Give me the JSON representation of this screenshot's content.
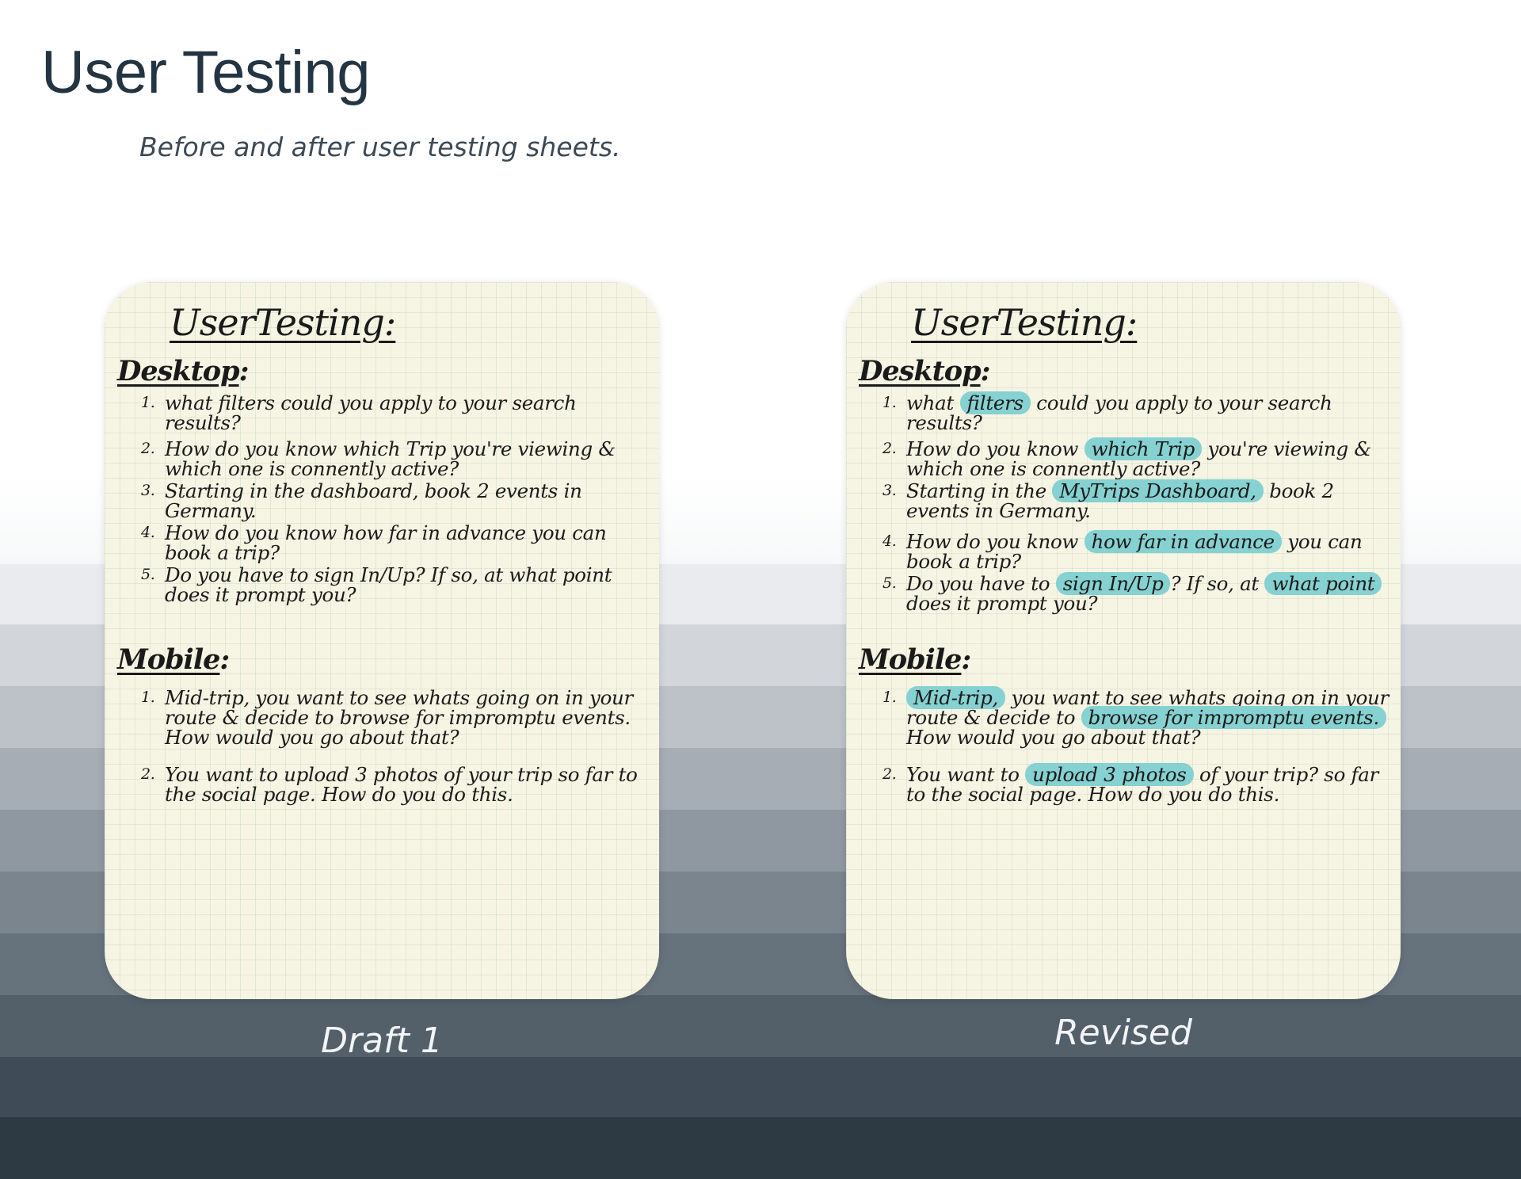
{
  "header": {
    "title": "User Testing",
    "subtitle": "Before and after user testing sheets."
  },
  "background": {
    "band_colors": [
      "#ffffff",
      "#e9ebee",
      "#d2d6da",
      "#bcc2c8",
      "#a6adb4",
      "#8f98a1",
      "#7b858e",
      "#66727c",
      "#535f69",
      "#3f4c57",
      "#2d3a44"
    ]
  },
  "colors": {
    "title": "#233442",
    "paper": "#f6f4e3",
    "highlight": "#86d1d1"
  },
  "sheets": [
    {
      "caption": "Draft 1",
      "title": "UserTesting:",
      "desktop": {
        "heading": "Desktop",
        "questions": [
          {
            "num": "1.",
            "parts": [
              {
                "t": "what filters could you apply to your search results?"
              }
            ]
          },
          {
            "num": "2.",
            "parts": [
              {
                "t": "How do you know which Trip you're viewing & which one is connently active?"
              }
            ]
          },
          {
            "num": "3.",
            "parts": [
              {
                "t": "Starting in the dashboard, book 2 events in Germany."
              }
            ]
          },
          {
            "num": "4.",
            "parts": [
              {
                "t": "How do you know how far in advance you can book a trip?"
              }
            ]
          },
          {
            "num": "5.",
            "parts": [
              {
                "t": "Do you have to sign In/Up? If so, at what point does it prompt you?"
              }
            ]
          }
        ]
      },
      "mobile": {
        "heading": "Mobile",
        "questions": [
          {
            "num": "1.",
            "parts": [
              {
                "t": "Mid-trip, you want to see whats going on in your route & decide to browse for impromptu events. How would you go about that?"
              }
            ]
          },
          {
            "num": "2.",
            "parts": [
              {
                "t": "You want to upload 3 photos of your trip so far to the social page. How do you do this."
              }
            ]
          }
        ]
      }
    },
    {
      "caption": "Revised",
      "title": "UserTesting:",
      "desktop": {
        "heading": "Desktop",
        "questions": [
          {
            "num": "1.",
            "parts": [
              {
                "t": "what "
              },
              {
                "t": "filters",
                "hl": true
              },
              {
                "t": " could you apply to your search results?"
              }
            ]
          },
          {
            "num": "2.",
            "parts": [
              {
                "t": "How do you know "
              },
              {
                "t": "which Trip",
                "hl": true
              },
              {
                "t": " you're viewing & which one is connently active?"
              }
            ]
          },
          {
            "num": "3.",
            "parts": [
              {
                "t": "Starting in the "
              },
              {
                "t": "MyTrips Dashboard,",
                "hl": true
              },
              {
                "t": " book 2 events in Germany."
              }
            ]
          },
          {
            "num": "4.",
            "parts": [
              {
                "t": "How do you know "
              },
              {
                "t": "how far in advance",
                "hl": true
              },
              {
                "t": " you can book a trip?"
              }
            ]
          },
          {
            "num": "5.",
            "parts": [
              {
                "t": "Do you have to "
              },
              {
                "t": "sign In/Up",
                "hl": true
              },
              {
                "t": "? If so, at "
              },
              {
                "t": "what point",
                "hl": true
              },
              {
                "t": " does it prompt you?"
              }
            ]
          }
        ]
      },
      "mobile": {
        "heading": "Mobile",
        "questions": [
          {
            "num": "1.",
            "parts": [
              {
                "t": "Mid-trip,",
                "hl": true
              },
              {
                "t": " you want to see whats going on in your route & decide to "
              },
              {
                "t": "browse for impromptu events.",
                "hl": true
              },
              {
                "t": " How would you go about that?"
              }
            ]
          },
          {
            "num": "2.",
            "parts": [
              {
                "t": "You want to "
              },
              {
                "t": "upload 3 photos",
                "hl": true
              },
              {
                "t": " of your trip? so far to the social page. How do you do this."
              }
            ]
          }
        ]
      }
    }
  ]
}
